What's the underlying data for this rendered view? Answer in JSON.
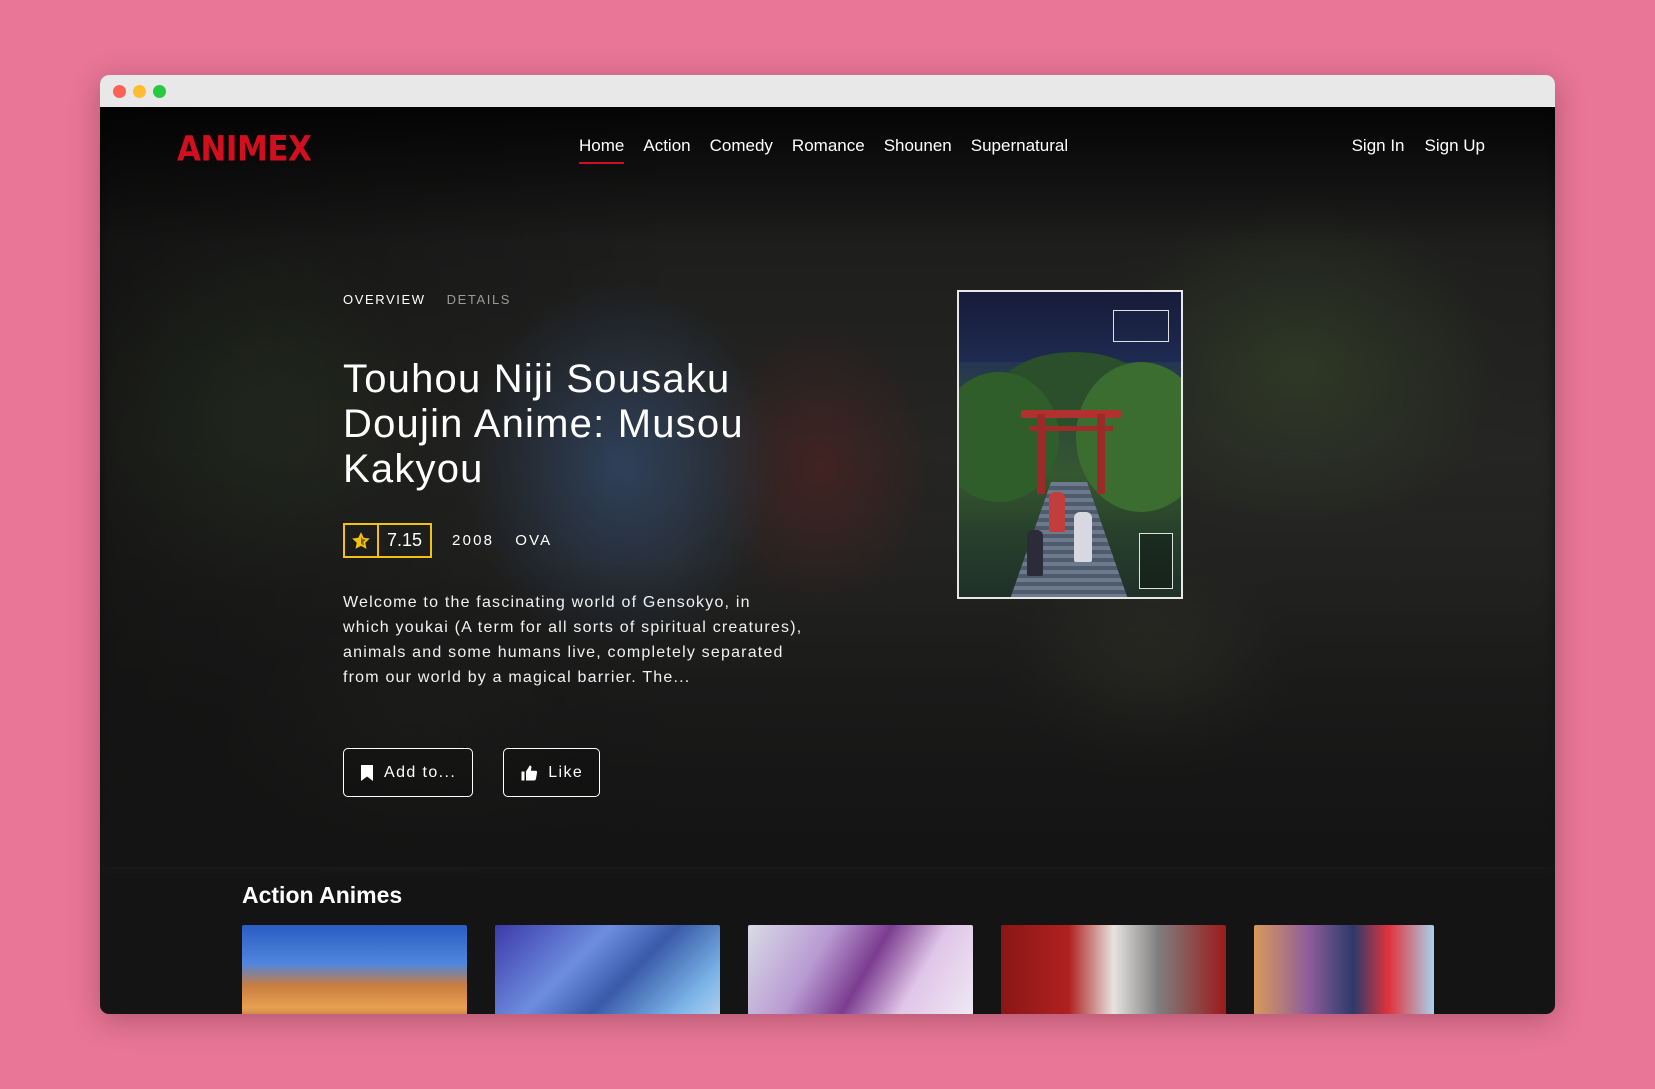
{
  "brand": {
    "logo": "ANIMEX",
    "color": "#d10f1e"
  },
  "nav": {
    "items": [
      {
        "label": "Home",
        "active": true
      },
      {
        "label": "Action"
      },
      {
        "label": "Comedy"
      },
      {
        "label": "Romance"
      },
      {
        "label": "Shounen"
      },
      {
        "label": "Supernatural"
      }
    ],
    "auth": {
      "sign_in": "Sign In",
      "sign_up": "Sign Up"
    }
  },
  "hero": {
    "tabs": [
      {
        "label": "OVERVIEW",
        "active": true
      },
      {
        "label": "DETAILS"
      }
    ],
    "title": "Touhou Niji Sousaku Doujin Anime: Musou Kakyou",
    "rating": {
      "value": "7.15",
      "icon": "star-icon",
      "color": "#f3c10f"
    },
    "year": "2008",
    "type": "OVA",
    "description": "Welcome to the fascinating world of Gensokyo, in which youkai (A term for all sorts of spiritual creatures), animals and some humans live, completely separated from our world by a magical barrier. The...",
    "actions": {
      "add_to": {
        "label": "Add to...",
        "icon": "bookmark-icon"
      },
      "like": {
        "label": "Like",
        "icon": "thumbs-up-icon"
      }
    }
  },
  "rows": [
    {
      "title": "Action Animes",
      "card_count": 5
    }
  ]
}
